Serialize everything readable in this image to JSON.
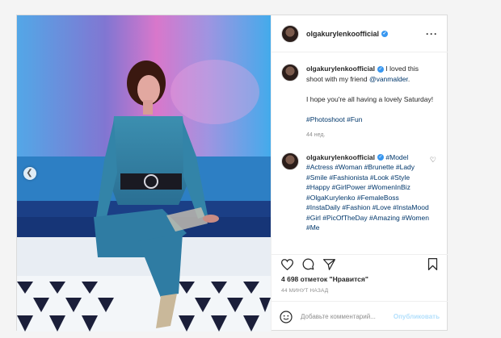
{
  "post": {
    "username": "olgakurylenkoofficial",
    "more_icon": "more-options-icon",
    "verified_icon": "verified-badge-icon"
  },
  "caption": {
    "username": "olgakurylenkoofficial",
    "text_part1": " I loved this shoot with my friend ",
    "mention": "@vanmalder",
    "text_part2": ".",
    "line2": "I hope you're all having a lovely Saturday!",
    "tags": "#Photoshoot #Fun",
    "time": "44 нед."
  },
  "comment": {
    "username": "olgakurylenkoofficial",
    "tags": " #Model #Actress #Woman #Brunette #Lady #Smile #Fashionista #Look #Style #Happy #GirlPower #WomenInBiz #OlgaKurylenko #FemaleBoss #InstaDaily #Fashion #Love #InstaMood #Girl #PicOfTheDay #Amazing #Women #Me"
  },
  "actions": {
    "icons": [
      "heart-icon",
      "comment-icon",
      "share-icon",
      "save-icon"
    ]
  },
  "likes_text": "4 698 отметок \"Нравится\"",
  "post_time": "44 МИНУТ НАЗАД",
  "add_comment": {
    "placeholder": "Добавьте комментарий...",
    "publish_label": "Опубликовать"
  },
  "colors": {
    "link": "#00376b",
    "publish": "#b2dffc",
    "verified": "#3897f0"
  }
}
